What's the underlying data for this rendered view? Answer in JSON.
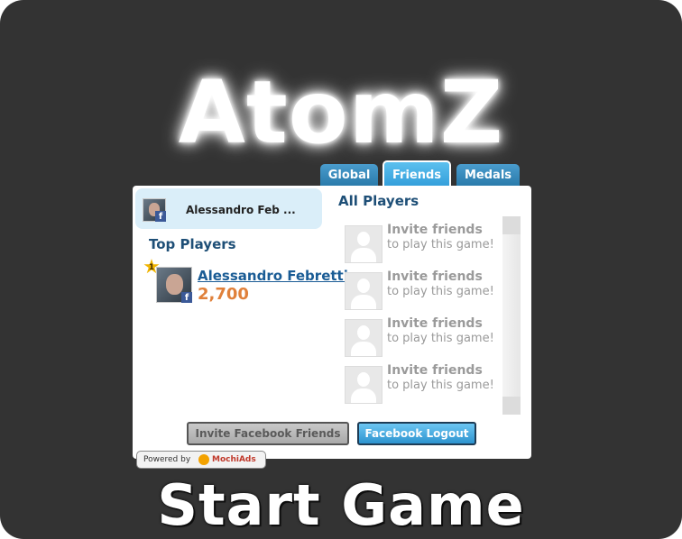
{
  "game": {
    "title": "AtomZ",
    "start_label": "Start Game"
  },
  "tabs": [
    {
      "label": "Global",
      "active": false
    },
    {
      "label": "Friends",
      "active": true
    },
    {
      "label": "Medals",
      "active": false
    }
  ],
  "current_user": {
    "name": "Alessandro Feb ...",
    "fb_icon": "f"
  },
  "top_players": {
    "heading": "Top Players",
    "entries": [
      {
        "rank": "1",
        "name": "Alessandro Febretti",
        "score": "2,700"
      }
    ]
  },
  "all_players": {
    "heading": "All Players",
    "invites": [
      {
        "line1": "Invite friends",
        "line2": "to play this game!"
      },
      {
        "line1": "Invite friends",
        "line2": "to play this game!"
      },
      {
        "line1": "Invite friends",
        "line2": "to play this game!"
      },
      {
        "line1": "Invite friends",
        "line2": "to play this game!"
      }
    ]
  },
  "buttons": {
    "invite_fb": "Invite Facebook Friends",
    "fb_logout": "Facebook Logout"
  },
  "powered": {
    "prefix": "Powered by",
    "brand": "MochiAds"
  },
  "colors": {
    "background": "#333333",
    "tab_blue": "#2f8ec5",
    "score_orange": "#e0803a",
    "link_blue": "#1a5c95"
  }
}
